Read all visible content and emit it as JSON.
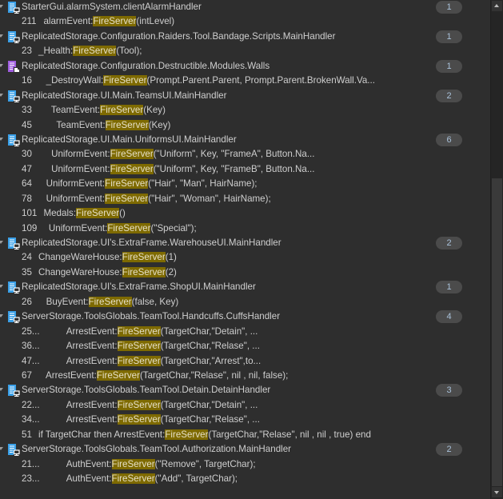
{
  "match_term": "FireServer",
  "colors": {
    "background": "#2e2e2e",
    "highlight": "#7e6a00",
    "server_script_icon": "#3aa0e8",
    "module_script_icon": "#a05ee0"
  },
  "groups": [
    {
      "path": "StarterGui.alarmSystem.clientAlarmHandler",
      "icon": "script-icon",
      "count": "1",
      "results": [
        {
          "line": "211",
          "pre": "  alarmEvent:",
          "post": "(intLevel)"
        }
      ]
    },
    {
      "path": "ReplicatedStorage.Configuration.Raiders.Tool.Bandage.Scripts.MainHandler",
      "icon": "script-icon",
      "count": "1",
      "results": [
        {
          "line": "23",
          "pre": "_Health:",
          "post": "(Tool);"
        }
      ]
    },
    {
      "path": "ReplicatedStorage.Configuration.Destructible.Modules.Walls",
      "icon": "module-script-icon",
      "count": "1",
      "results": [
        {
          "line": "16",
          "pre": "   _DestroyWall:",
          "post": "(Prompt.Parent.Parent, Prompt.Parent.BrokenWall.Va..."
        }
      ]
    },
    {
      "path": "ReplicatedStorage.UI.Main.TeamsUI.MainHandler",
      "icon": "script-icon",
      "count": "2",
      "results": [
        {
          "line": "33",
          "pre": "     TeamEvent:",
          "post": "(Key)"
        },
        {
          "line": "45",
          "pre": "       TeamEvent:",
          "post": "(Key)"
        }
      ]
    },
    {
      "path": "ReplicatedStorage.UI.Main.UniformsUI.MainHandler",
      "icon": "script-icon",
      "count": "6",
      "results": [
        {
          "line": "30",
          "pre": "     UniformEvent:",
          "post": "(\"Uniform\", Key, \"FrameA\", Button.Na..."
        },
        {
          "line": "47",
          "pre": "     UniformEvent:",
          "post": "(\"Uniform\", Key, \"FrameB\", Button.Na..."
        },
        {
          "line": "64",
          "pre": "   UniformEvent:",
          "post": "(\"Hair\", \"Man\", HairName);"
        },
        {
          "line": "78",
          "pre": "   UniformEvent:",
          "post": "(\"Hair\", \"Woman\", HairName);"
        },
        {
          "line": "101",
          "pre": "  Medals:",
          "post": "()"
        },
        {
          "line": "109",
          "pre": "    UniformEvent:",
          "post": "(\"Special\");"
        }
      ]
    },
    {
      "path": "ReplicatedStorage.UI's.ExtraFrame.WarehouseUI.MainHandler",
      "icon": "script-icon",
      "count": "2",
      "results": [
        {
          "line": "24",
          "pre": "ChangeWareHouse:",
          "post": "(1)"
        },
        {
          "line": "35",
          "pre": "ChangeWareHouse:",
          "post": "(2)"
        }
      ]
    },
    {
      "path": "ReplicatedStorage.UI's.ExtraFrame.ShopUI.MainHandler",
      "icon": "script-icon",
      "count": "1",
      "results": [
        {
          "line": "26",
          "pre": "   BuyEvent:",
          "post": "(false, Key)"
        }
      ]
    },
    {
      "path": "ServerStorage.ToolsGlobals.TeamTool.Handcuffs.CuffsHandler",
      "icon": "script-icon",
      "count": "4",
      "results": [
        {
          "line": "25...",
          "pre": "           ArrestEvent:",
          "post": "(TargetChar,\"Detain\", ..."
        },
        {
          "line": "36...",
          "pre": "           ArrestEvent:",
          "post": "(TargetChar,\"Relase\", ..."
        },
        {
          "line": "47...",
          "pre": "           ArrestEvent:",
          "post": "(TargetChar,\"Arrest\",to..."
        },
        {
          "line": "67",
          "pre": "   ArrestEvent:",
          "post": "(TargetChar,\"Relase\", nil , nil, false);"
        }
      ]
    },
    {
      "path": "ServerStorage.ToolsGlobals.TeamTool.Detain.DetainHandler",
      "icon": "script-icon",
      "count": "3",
      "results": [
        {
          "line": "22...",
          "pre": "           ArrestEvent:",
          "post": "(TargetChar,\"Detain\", ..."
        },
        {
          "line": "34...",
          "pre": "           ArrestEvent:",
          "post": "(TargetChar,\"Relase\", ..."
        },
        {
          "line": "51",
          "pre": "if TargetChar then ArrestEvent:",
          "post": "(TargetChar,\"Relase\", nil , nil , true) end"
        }
      ]
    },
    {
      "path": "ServerStorage.ToolsGlobals.TeamTool.Authorization.MainHandler",
      "icon": "script-icon",
      "count": "2",
      "results": [
        {
          "line": "21...",
          "pre": "           AuthEvent:",
          "post": "(\"Remove\", TargetChar);"
        },
        {
          "line": "23...",
          "pre": "           AuthEvent:",
          "post": "(\"Add\", TargetChar);"
        }
      ]
    }
  ]
}
